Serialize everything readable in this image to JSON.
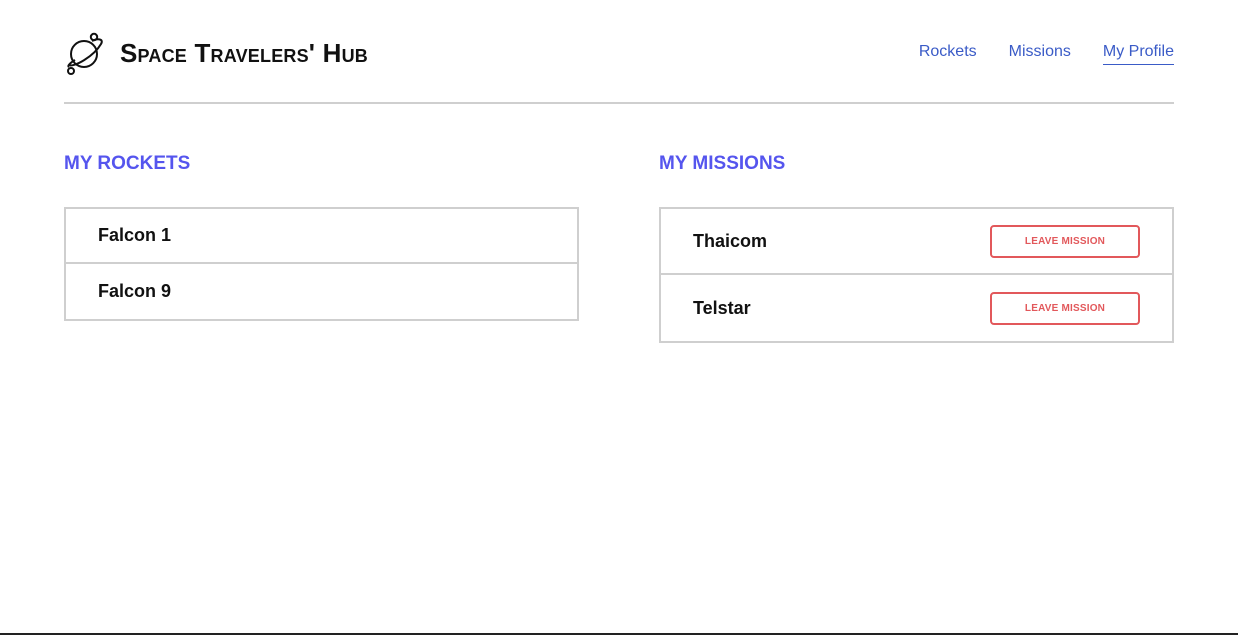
{
  "header": {
    "title": "Space Travelers' Hub",
    "logo_icon": "planet-icon"
  },
  "nav": {
    "items": [
      {
        "label": "Rockets",
        "active": false
      },
      {
        "label": "Missions",
        "active": false
      },
      {
        "label": "My Profile",
        "active": true
      }
    ]
  },
  "rockets": {
    "heading": "My Rockets",
    "items": [
      "Falcon 1",
      "Falcon 9"
    ]
  },
  "missions": {
    "heading": "My Missions",
    "items": [
      {
        "name": "Thaicom",
        "button_label": "Leave Mission"
      },
      {
        "name": "Telstar",
        "button_label": "Leave Mission"
      }
    ]
  },
  "colors": {
    "nav_link": "#3a5bc7",
    "section_heading": "#5555ee",
    "leave_button": "#e2585b",
    "border": "#cfcfcf"
  }
}
